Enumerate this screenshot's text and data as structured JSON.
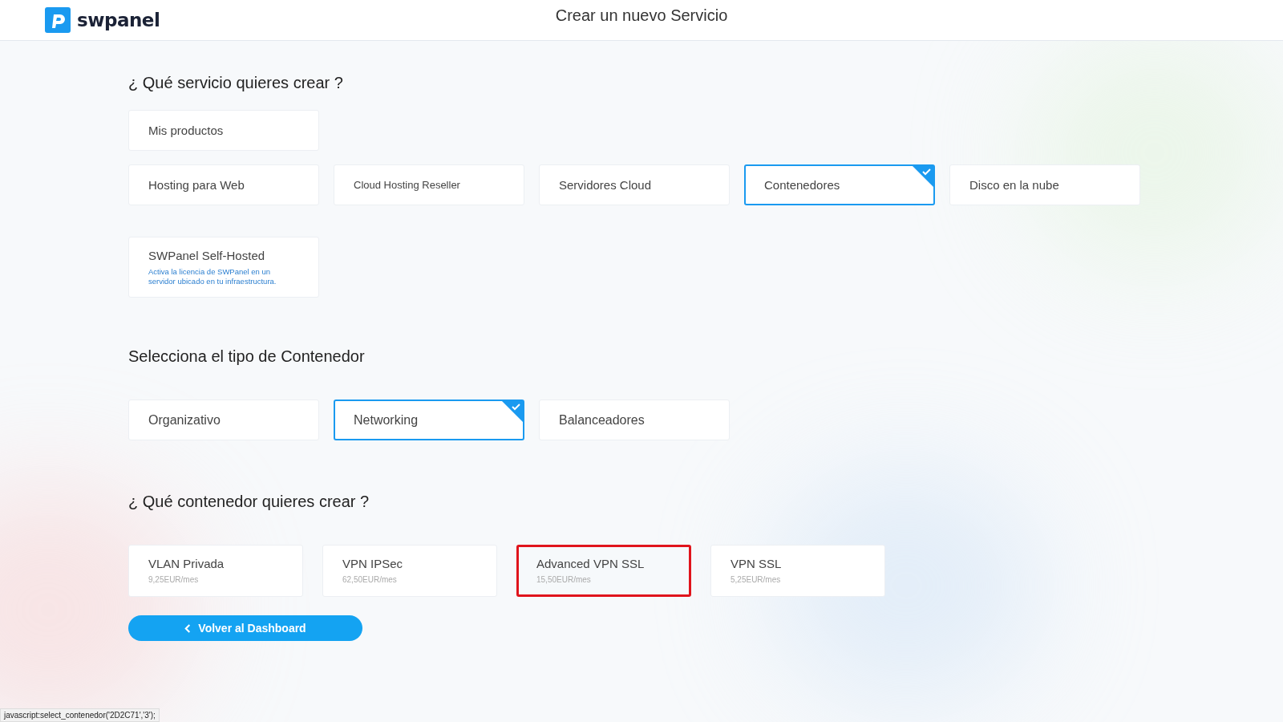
{
  "header": {
    "logo_text": "swpanel",
    "title": "Crear un nuevo Servicio"
  },
  "service_section": {
    "heading": "¿ Qué servicio quieres crear ?",
    "rows": [
      {
        "items": [
          {
            "label": "Mis productos",
            "selected": false
          }
        ]
      },
      {
        "items": [
          {
            "label": "Hosting para Web",
            "selected": false
          },
          {
            "label": "Cloud Hosting Reseller",
            "selected": false
          },
          {
            "label": "Servidores Cloud",
            "selected": false
          },
          {
            "label": "Contenedores",
            "selected": true
          },
          {
            "label": "Disco en la nube",
            "selected": false
          }
        ]
      },
      {
        "items": [
          {
            "label": "SWPanel Self-Hosted",
            "description": "Activa la licencia de SWPanel en un servidor ubicado en tu infraestructura.",
            "selected": false
          }
        ]
      }
    ]
  },
  "type_section": {
    "heading": "Selecciona el tipo de Contenedor",
    "items": [
      {
        "label": "Organizativo",
        "selected": false
      },
      {
        "label": "Networking",
        "selected": true
      },
      {
        "label": "Balanceadores",
        "selected": false
      }
    ]
  },
  "container_section": {
    "heading": "¿ Qué contenedor quieres crear ?",
    "items": [
      {
        "name": "VLAN Privada",
        "price": "9,25EUR/mes",
        "highlighted": false
      },
      {
        "name": "VPN IPSec",
        "price": "62,50EUR/mes",
        "highlighted": false
      },
      {
        "name": "Advanced VPN SSL",
        "price": "15,50EUR/mes",
        "highlighted": true
      },
      {
        "name": "VPN SSL",
        "price": "5,25EUR/mes",
        "highlighted": false
      }
    ]
  },
  "back_button": {
    "label": "Volver al Dashboard"
  },
  "status_bar": {
    "text": "javascript:select_contenedor('2D2C71','3');"
  }
}
